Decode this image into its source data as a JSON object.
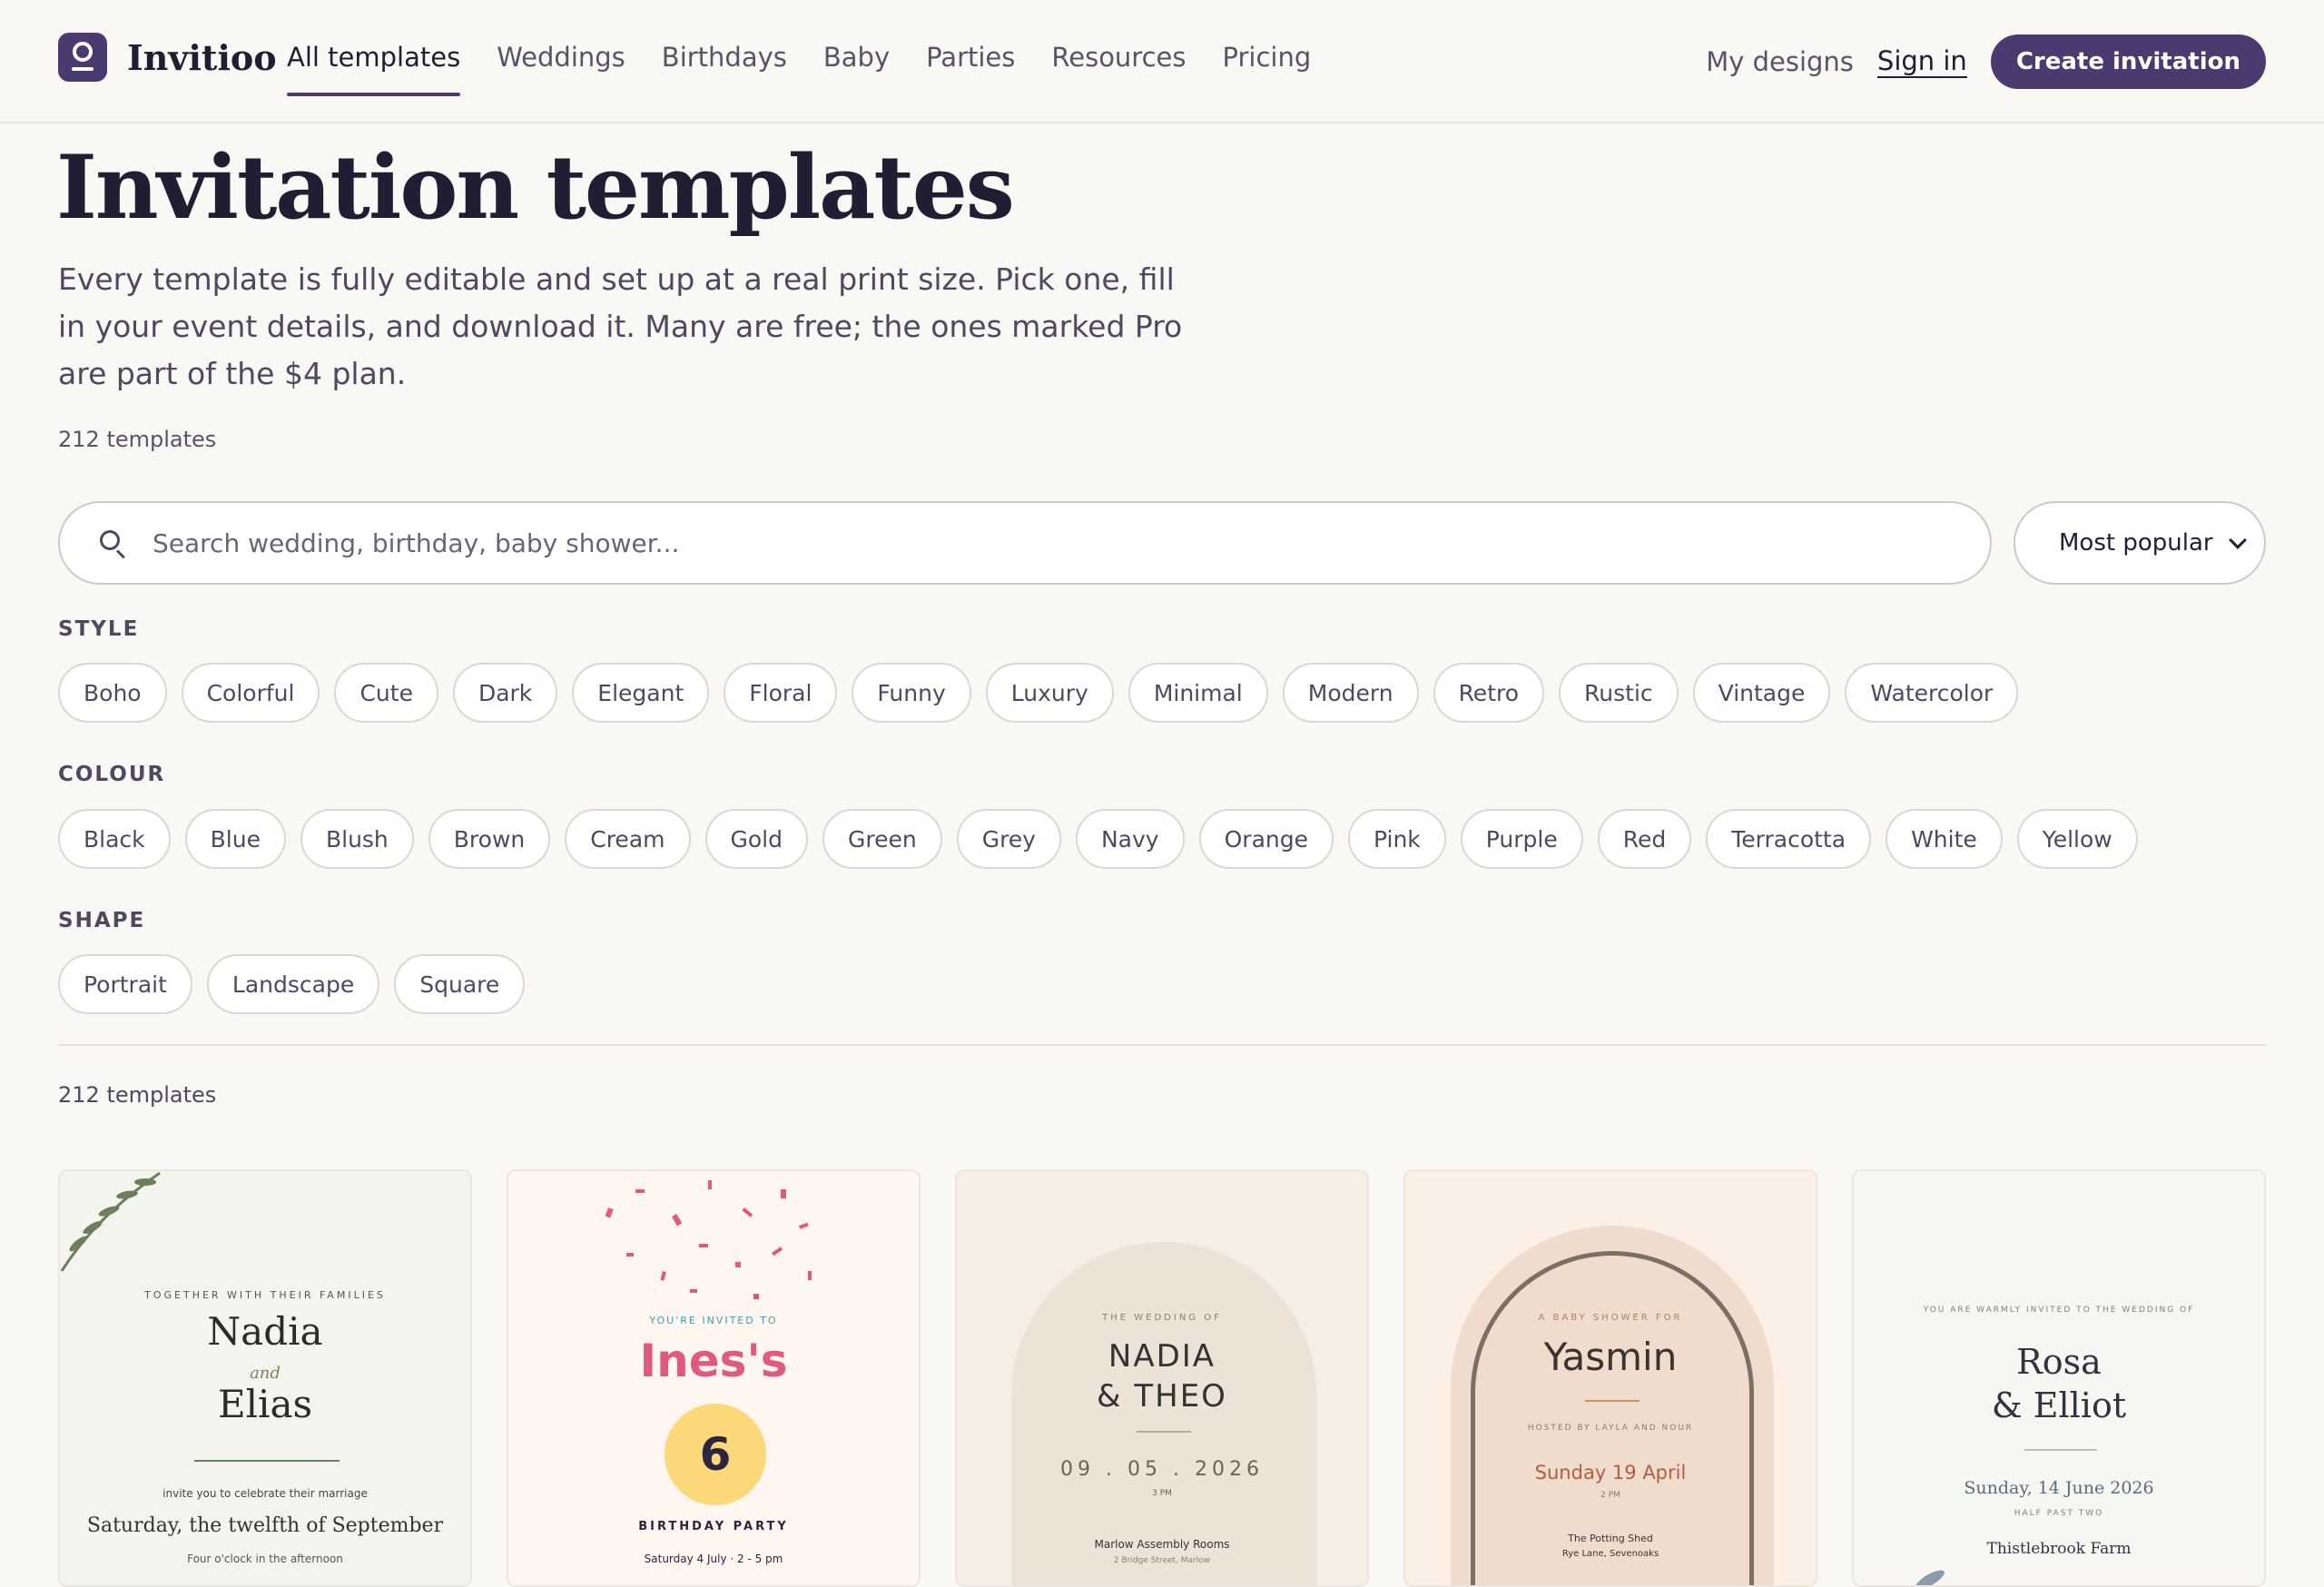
{
  "brand": {
    "name": "Invitioo"
  },
  "nav": {
    "items": [
      {
        "label": "All templates",
        "active": true
      },
      {
        "label": "Weddings"
      },
      {
        "label": "Birthdays"
      },
      {
        "label": "Baby"
      },
      {
        "label": "Parties"
      },
      {
        "label": "Resources"
      },
      {
        "label": "Pricing"
      }
    ],
    "my_designs": "My designs",
    "sign_in": "Sign in",
    "create": "Create invitation"
  },
  "hero": {
    "title": "Invitation templates",
    "lede": "Every template is fully editable and set up at a real print size. Pick one, fill in your event details, and download it. Many are free; the ones marked Pro are part of the $4 plan.",
    "count": "212 templates"
  },
  "search": {
    "placeholder": "Search wedding, birthday, baby shower...",
    "value": ""
  },
  "sort": {
    "selected": "Most popular"
  },
  "filters": {
    "style": {
      "label": "STYLE",
      "options": [
        "Boho",
        "Colorful",
        "Cute",
        "Dark",
        "Elegant",
        "Floral",
        "Funny",
        "Luxury",
        "Minimal",
        "Modern",
        "Retro",
        "Rustic",
        "Vintage",
        "Watercolor"
      ]
    },
    "colour": {
      "label": "COLOUR",
      "options": [
        "Black",
        "Blue",
        "Blush",
        "Brown",
        "Cream",
        "Gold",
        "Green",
        "Grey",
        "Navy",
        "Orange",
        "Pink",
        "Purple",
        "Red",
        "Terracotta",
        "White",
        "Yellow"
      ]
    },
    "shape": {
      "label": "SHAPE",
      "options": [
        "Portrait",
        "Landscape",
        "Square"
      ]
    }
  },
  "results": {
    "count": "212 templates"
  },
  "colors": {
    "accent": "#4b3a70",
    "background": "#faf8f4",
    "pink": "#e05a80"
  },
  "cards": [
    {
      "kicker": "TOGETHER WITH THEIR FAMILIES",
      "name1": "Nadia",
      "and": "and",
      "name2": "Elias",
      "line": "invite you to celebrate their marriage",
      "date": "Saturday, the twelfth of September",
      "time": "Four o'clock in the afternoon"
    },
    {
      "kicker": "YOU'RE INVITED TO",
      "name": "Ines's",
      "age": "6",
      "event": "BIRTHDAY PARTY",
      "date": "Saturday 4 July · 2 - 5 pm"
    },
    {
      "kicker": "THE WEDDING OF",
      "name1": "NADIA",
      "name2": "& THEO",
      "date": "09 . 05 . 2026",
      "time": "3 PM",
      "venue": "Marlow Assembly Rooms",
      "address": "2 Bridge Street, Marlow"
    },
    {
      "kicker": "A BABY SHOWER FOR",
      "name": "Yasmin",
      "host": "HOSTED BY LAYLA AND NOUR",
      "date": "Sunday 19 April",
      "time": "2 PM",
      "venue": "The Potting Shed",
      "address": "Rye Lane, Sevenoaks"
    },
    {
      "kicker": "YOU ARE WARMLY INVITED TO THE WEDDING OF",
      "name1": "Rosa",
      "name2": "& Elliot",
      "date": "Sunday, 14 June 2026",
      "time": "HALF PAST TWO",
      "venue": "Thistlebrook Farm"
    }
  ]
}
